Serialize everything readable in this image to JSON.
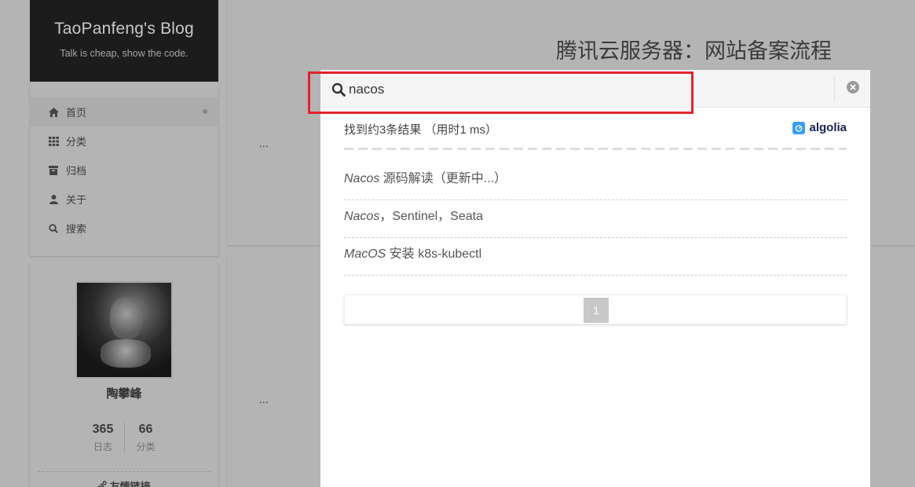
{
  "site": {
    "title": "TaoPanfeng's Blog",
    "subtitle": "Talk is cheap, show the code."
  },
  "menu": {
    "items": [
      {
        "label": "首页",
        "icon": "home-icon",
        "active": true
      },
      {
        "label": "分类",
        "icon": "th-icon"
      },
      {
        "label": "归档",
        "icon": "archive-icon"
      },
      {
        "label": "关于",
        "icon": "user-icon"
      },
      {
        "label": "搜索",
        "icon": "search-icon"
      }
    ]
  },
  "profile": {
    "name": "陶攀峰",
    "posts_count": "365",
    "posts_label": "日志",
    "categories_count": "66",
    "categories_label": "分类",
    "links_title": "友情链接"
  },
  "posts": [
    {
      "title": "腾讯云服务器：网站备案流程",
      "excerpt": "..."
    },
    {
      "excerpt": "..."
    }
  ],
  "search": {
    "query": "nacos",
    "stats": "找到约3条结果 （用时1 ms）",
    "provider": "algolia",
    "hits": [
      {
        "em": "Nacos",
        "rest": " 源码解读（更新中...）"
      },
      {
        "em": "Nacos",
        "rest": "，Sentinel，Seata"
      },
      {
        "em": "MacOS",
        "rest": " 安装 k8s-kubectl"
      }
    ],
    "pagination": {
      "current": "1"
    }
  },
  "colors": {
    "highlight_box": "#e0242e",
    "algolia_blue": "#3a9ff3"
  }
}
